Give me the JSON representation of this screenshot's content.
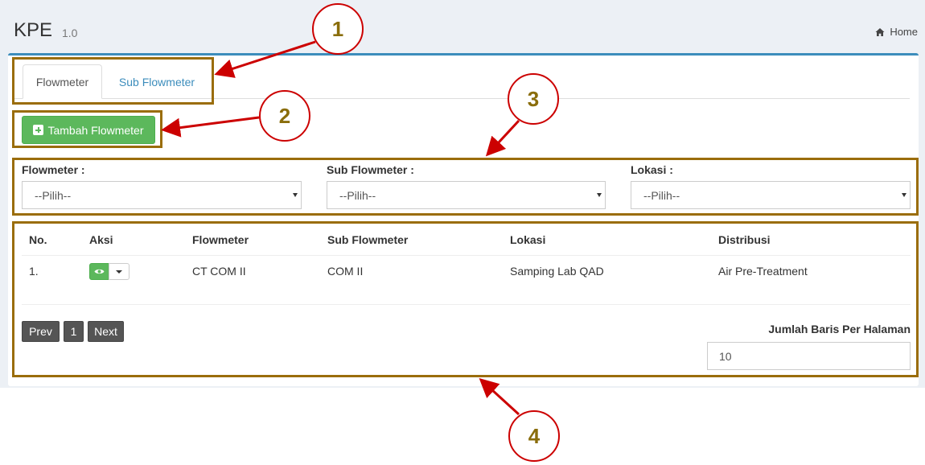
{
  "header": {
    "title": "KPE",
    "version": "1.0",
    "home_label": "Home"
  },
  "tabs": [
    {
      "label": "Flowmeter",
      "active": true
    },
    {
      "label": "Sub Flowmeter",
      "active": false
    }
  ],
  "add_button_label": "Tambah Flowmeter",
  "filters": [
    {
      "label": "Flowmeter :",
      "value": "--Pilih--"
    },
    {
      "label": "Sub Flowmeter :",
      "value": "--Pilih--"
    },
    {
      "label": "Lokasi :",
      "value": "--Pilih--"
    }
  ],
  "table": {
    "columns": [
      "No.",
      "Aksi",
      "Flowmeter",
      "Sub Flowmeter",
      "Lokasi",
      "Distribusi"
    ],
    "rows": [
      {
        "no": "1.",
        "flowmeter": "CT COM II",
        "sub_flowmeter": "COM II",
        "lokasi": "Samping Lab QAD",
        "distribusi": "Air Pre-Treatment"
      }
    ]
  },
  "pagination": {
    "prev": "Prev",
    "page": "1",
    "next": "Next"
  },
  "rows_per_page": {
    "label": "Jumlah Baris Per Halaman",
    "value": "10"
  },
  "annotations": [
    "1",
    "2",
    "3",
    "4"
  ],
  "colors": {
    "accent": "#3c8dbc",
    "success": "#5cb85c",
    "annotation_border": "#9a6d0b",
    "annotation_arrow": "#cc0000"
  }
}
